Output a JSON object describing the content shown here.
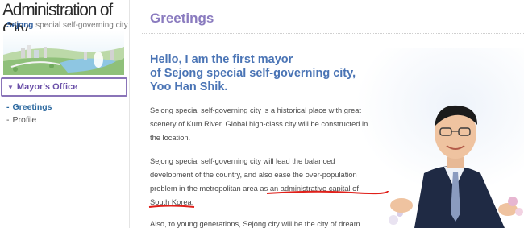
{
  "sidebar": {
    "site_title": "Administration of City",
    "site_subtitle_bold": "Sejong",
    "site_subtitle_rest": " special self-governing city",
    "menu_head": "Mayor's Office",
    "items": [
      {
        "label": "Greetings",
        "active": true
      },
      {
        "label": "Profile",
        "active": false
      }
    ]
  },
  "main": {
    "title": "Greetings",
    "headline": [
      "Hello, I am the first mayor",
      "of Sejong special self-governing city,",
      "Yoo Han Shik."
    ],
    "paragraph1": [
      "Sejong special self-governing city is a historical place with great",
      "scenery of Kum River. Global high-class city will be constructed in",
      "the location."
    ],
    "paragraph2": {
      "line1": "Sejong special self-governing city will lead the balanced",
      "line2": "development of the country, and also ease the over-population",
      "line3_plain": "problem in the metropolitan area as ",
      "line3_underlined": "an administrative capital of",
      "line4_underlined": "South Korea",
      "line4_rest": "."
    },
    "paragraph3": [
      "Also, to young generations, Sejong city will be the city of dream"
    ]
  },
  "colors": {
    "title_purple": "#8a7bbf",
    "headline_blue": "#4a74b5",
    "menu_purple": "#6a4fa8",
    "underline_red": "#e0201a"
  },
  "icons": [
    "caret-down-icon",
    "city-illustration",
    "mayor-photo"
  ]
}
